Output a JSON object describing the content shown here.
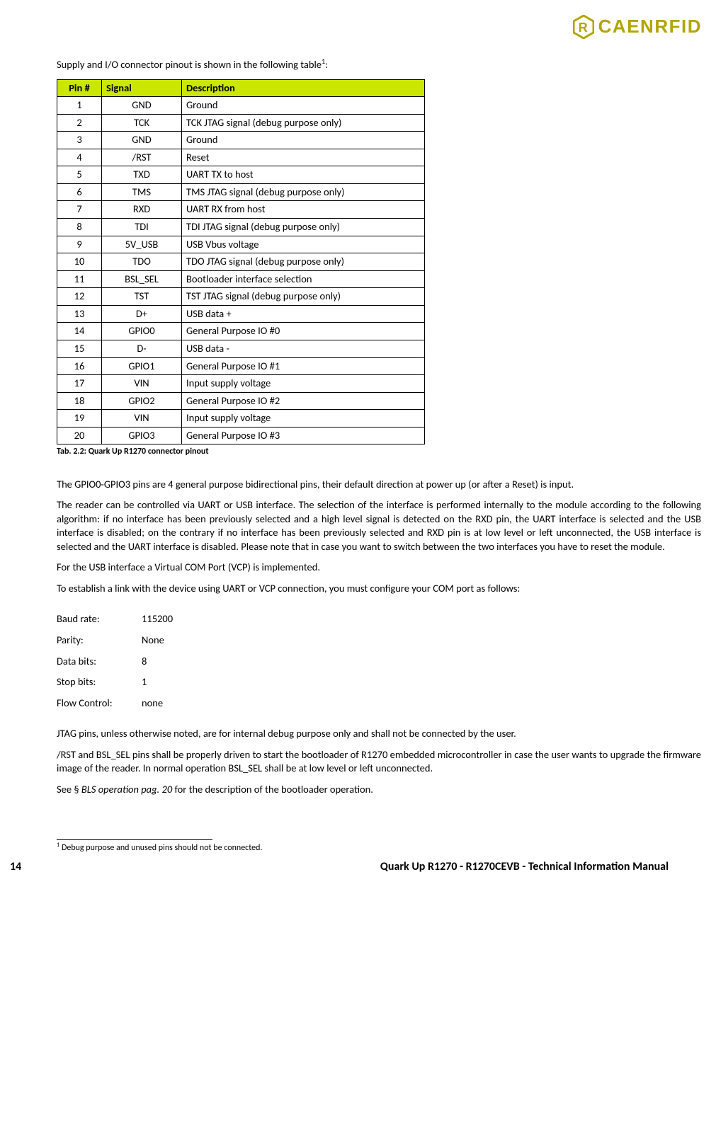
{
  "logo": {
    "text": "CAENRFID"
  },
  "intro": {
    "text": "Supply and I/O connector pinout is shown in the following table",
    "sup": "1",
    "suffix": ":"
  },
  "table": {
    "headers": {
      "pin": "Pin #",
      "signal": "Signal",
      "desc": "Description"
    },
    "rows": [
      {
        "pin": "1",
        "signal": "GND",
        "desc": "Ground"
      },
      {
        "pin": "2",
        "signal": "TCK",
        "desc": "TCK JTAG signal (debug purpose only)"
      },
      {
        "pin": "3",
        "signal": "GND",
        "desc": "Ground"
      },
      {
        "pin": "4",
        "signal": "/RST",
        "desc": "Reset"
      },
      {
        "pin": "5",
        "signal": "TXD",
        "desc": "UART TX to host"
      },
      {
        "pin": "6",
        "signal": "TMS",
        "desc": "TMS JTAG signal (debug purpose only)"
      },
      {
        "pin": "7",
        "signal": "RXD",
        "desc": "UART RX from host"
      },
      {
        "pin": "8",
        "signal": "TDI",
        "desc": "TDI JTAG signal (debug purpose only)"
      },
      {
        "pin": "9",
        "signal": "5V_USB",
        "desc": "USB Vbus voltage"
      },
      {
        "pin": "10",
        "signal": "TDO",
        "desc": "TDO JTAG signal (debug purpose only)"
      },
      {
        "pin": "11",
        "signal": "BSL_SEL",
        "desc": "Bootloader interface selection"
      },
      {
        "pin": "12",
        "signal": "TST",
        "desc": "TST JTAG signal (debug purpose only)"
      },
      {
        "pin": "13",
        "signal": "D+",
        "desc": "USB data +"
      },
      {
        "pin": "14",
        "signal": "GPIO0",
        "desc": "General Purpose IO #0"
      },
      {
        "pin": "15",
        "signal": "D-",
        "desc": "USB data -"
      },
      {
        "pin": "16",
        "signal": "GPIO1",
        "desc": "General Purpose IO #1"
      },
      {
        "pin": "17",
        "signal": "VIN",
        "desc": "Input supply voltage"
      },
      {
        "pin": "18",
        "signal": "GPIO2",
        "desc": "General Purpose IO #2"
      },
      {
        "pin": "19",
        "signal": "VIN",
        "desc": "Input supply voltage"
      },
      {
        "pin": "20",
        "signal": "GPIO3",
        "desc": "General Purpose IO #3"
      }
    ]
  },
  "caption": "Tab. 2.2: Quark Up R1270 connector pinout",
  "para1": "The GPIO0-GPIO3 pins are 4 general purpose bidirectional pins, their default direction at power up (or after a Reset) is input.",
  "para2": "The reader can be controlled via UART or USB interface. The selection of the interface is performed internally to the module according to the following algorithm: if no interface has been previously selected and a high level signal is detected on the RXD pin, the UART interface is selected and the USB interface is disabled; on the contrary if no interface has been previously selected and RXD pin is at low level or left unconnected, the USB interface is selected and the UART interface is disabled.  Please note that in case you want to switch between the two interfaces you have to reset the module.",
  "para3": "For the USB interface a Virtual COM Port (VCP) is implemented.",
  "para4": "To establish a link with the device using UART or VCP connection, you must configure your COM port as follows:",
  "settings": [
    {
      "label": "Baud rate:",
      "value": "115200"
    },
    {
      "label": "Parity:",
      "value": "None"
    },
    {
      "label": "Data bits:",
      "value": "8"
    },
    {
      "label": "Stop bits:",
      "value": "1"
    },
    {
      "label": "Flow Control:",
      "value": "none"
    }
  ],
  "para5": "JTAG pins, unless otherwise noted, are for internal debug purpose only and shall not be connected by the user.",
  "para6": "/RST and BSL_SEL pins shall be properly driven to start the bootloader of R1270 embedded microcontroller in case the user wants to upgrade the firmware image of the reader. In normal operation BSL_SEL shall be at low level or left unconnected.",
  "para7": {
    "prefix": "See § ",
    "italic": "BLS operation pag. 20",
    "suffix": " for the description of the bootloader operation."
  },
  "footnote": {
    "sup": "1",
    "text": " Debug purpose and unused pins should not be connected."
  },
  "footer": {
    "page": "14",
    "title": "Quark Up R1270 - R1270CEVB - Technical Information Manual"
  }
}
